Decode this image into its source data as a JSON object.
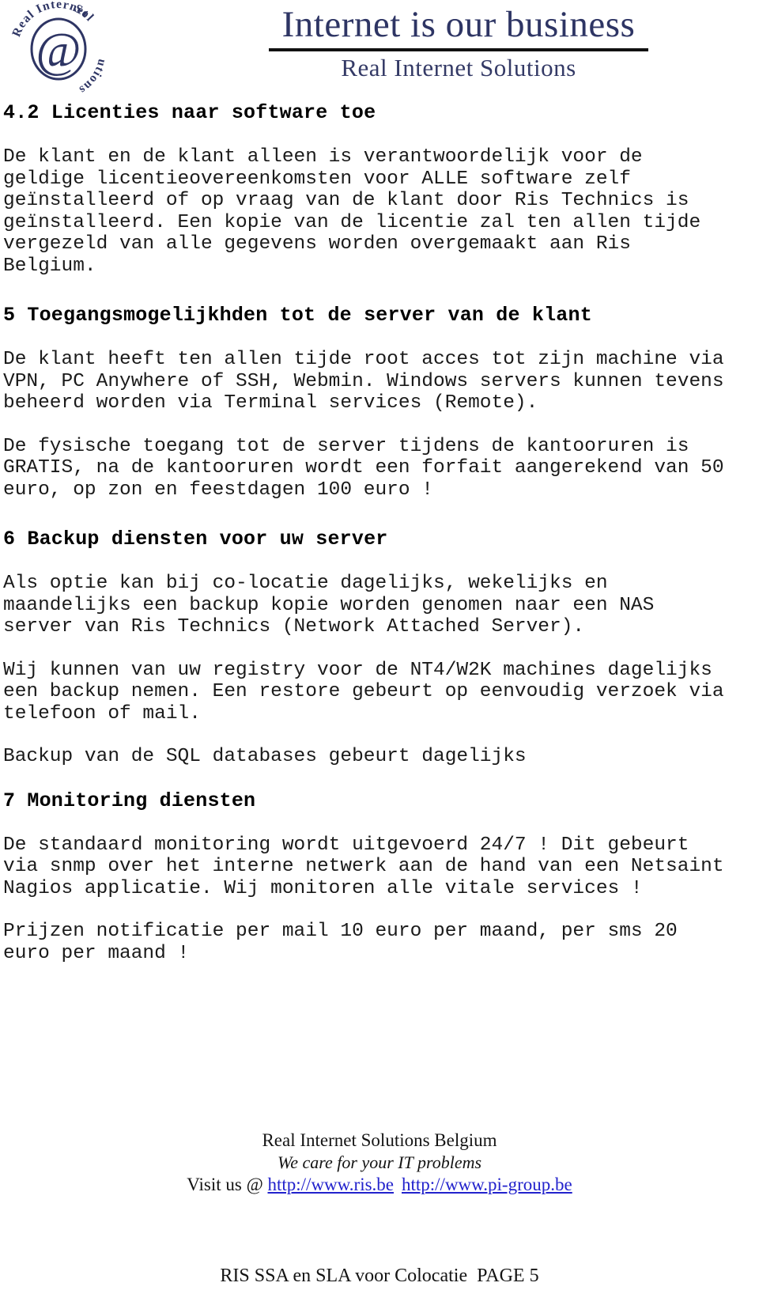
{
  "header": {
    "logo": {
      "icon": "at-symbol-circular-logo",
      "ring_text": "Real Internet Solutions",
      "center_glyph": "@",
      "color": "#2e3564"
    },
    "banner_title": "Internet is our business",
    "banner_subtitle": "Real Internet Solutions",
    "banner_color": "#2e3564"
  },
  "body": {
    "blocks": [
      {
        "type": "heading",
        "name": "section-4-2-heading",
        "text": "4.2 Licenties naar software toe"
      },
      {
        "type": "paragraph",
        "name": "section-4-2-paragraph",
        "text": "De klant en de klant alleen is verantwoordelijk voor de\ngeldige licentieovereenkomsten voor ALLE software zelf\ngeïnstalleerd of op vraag van de klant door Ris Technics is\ngeïnstalleerd. Een kopie van de licentie zal ten allen tijde\nvergezeld van alle gegevens worden overgemaakt aan Ris\nBelgium."
      },
      {
        "type": "heading",
        "name": "section-5-heading",
        "text": "5 Toegangsmogelijkhden tot de server van de klant"
      },
      {
        "type": "paragraph",
        "name": "section-5-paragraph-1",
        "text": "De klant heeft ten allen tijde root acces tot zijn machine via\nVPN, PC Anywhere of SSH, Webmin. Windows servers kunnen tevens\nbeheerd worden via Terminal services (Remote)."
      },
      {
        "type": "paragraph",
        "name": "section-5-paragraph-2",
        "text": "De fysische toegang tot de server tijdens de kantooruren is\nGRATIS, na de kantooruren wordt een forfait aangerekend van 50\neuro, op zon en feestdagen 100 euro !"
      },
      {
        "type": "heading",
        "name": "section-6-heading",
        "text": "6 Backup diensten voor uw server"
      },
      {
        "type": "paragraph",
        "name": "section-6-paragraph-1",
        "text": "Als optie kan bij co-locatie dagelijks, wekelijks en\nmaandelijks een backup kopie worden genomen naar een NAS\nserver van Ris Technics (Network Attached Server)."
      },
      {
        "type": "paragraph",
        "name": "section-6-paragraph-2",
        "text": "Wij kunnen van uw registry voor de NT4/W2K machines dagelijks\neen backup nemen. Een restore gebeurt op eenvoudig verzoek via\ntelefoon of mail."
      },
      {
        "type": "paragraph",
        "name": "section-6-paragraph-3",
        "text": "Backup van de SQL databases gebeurt dagelijks"
      },
      {
        "type": "heading",
        "name": "section-7-heading",
        "text": "7 Monitoring diensten"
      },
      {
        "type": "paragraph",
        "name": "section-7-paragraph-1",
        "text": "De standaard monitoring wordt uitgevoerd 24/7 ! Dit gebeurt\nvia snmp over het interne netwerk aan de hand van een Netsaint\nNagios applicatie. Wij monitoren alle vitale services !"
      },
      {
        "type": "paragraph",
        "name": "section-7-paragraph-2",
        "text": "Prijzen notificatie per mail 10 euro per maand, per sms 20\neuro per maand !"
      }
    ]
  },
  "footer": {
    "company": "Real Internet Solutions Belgium",
    "tagline": "We care for your IT problems",
    "visit_prefix": "Visit us @",
    "links": [
      "http://www.ris.be",
      "http://www.pi-group.be"
    ],
    "link_color": "#2222cc",
    "page_footer": "RIS SSA en SLA voor Colocatie  PAGE 5"
  }
}
